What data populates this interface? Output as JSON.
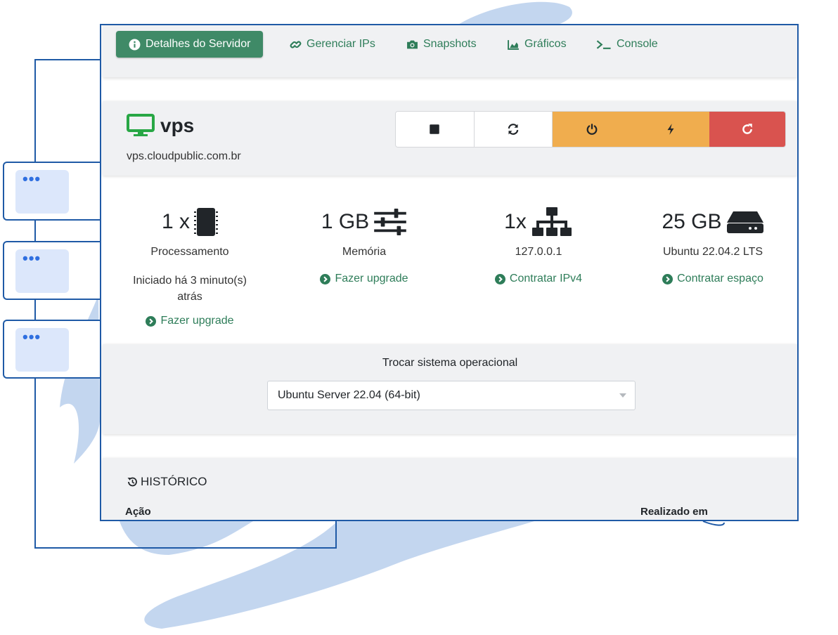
{
  "tabs": [
    {
      "label": "Detalhes do Servidor",
      "icon": "info-circle-icon",
      "active": true
    },
    {
      "label": "Gerenciar IPs",
      "icon": "link-icon",
      "active": false
    },
    {
      "label": "Snapshots",
      "icon": "camera-icon",
      "active": false
    },
    {
      "label": "Gráficos",
      "icon": "area-chart-icon",
      "active": false
    },
    {
      "label": "Console",
      "icon": "terminal-icon",
      "active": false
    }
  ],
  "server": {
    "name": "vps",
    "hostname": "vps.cloudpublic.com.br",
    "icon": "monitor-icon"
  },
  "controls": [
    {
      "icon": "stop-icon"
    },
    {
      "icon": "sync-icon"
    },
    {
      "icon": "power-icon"
    },
    {
      "icon": "bolt-icon"
    },
    {
      "icon": "redo-icon"
    }
  ],
  "stats": {
    "cpu": {
      "value": "1 x",
      "label": "Processamento",
      "sub": "Iniciado há 3 minuto(s) atrás",
      "link": "Fazer upgrade",
      "icon": "microchip-icon"
    },
    "memory": {
      "value": "1 GB",
      "label": "Memória",
      "link": "Fazer upgrade",
      "icon": "sliders-icon"
    },
    "network": {
      "value": "1x",
      "label": "127.0.0.1",
      "link": "Contratar IPv4",
      "icon": "sitemap-icon"
    },
    "disk": {
      "value": "25 GB",
      "label": "Ubuntu 22.04.2 LTS",
      "link": "Contratar espaço",
      "icon": "hdd-icon"
    }
  },
  "os": {
    "title": "Trocar sistema operacional",
    "selected": "Ubuntu Server 22.04 (64-bit)"
  },
  "history": {
    "title": "HISTÓRICO",
    "col_action": "Ação",
    "col_date": "Realizado em"
  },
  "side_cards": [
    {
      "dots": "•••"
    },
    {
      "dots": "•••"
    },
    {
      "dots": "•••"
    }
  ],
  "colors": {
    "accent_green": "#3f8a67",
    "link_green": "#2e7d59",
    "warning": "#f0ad4e",
    "danger": "#d9534f",
    "frame_blue": "#1f5aa6",
    "decor_blue": "#c3d6ef"
  }
}
